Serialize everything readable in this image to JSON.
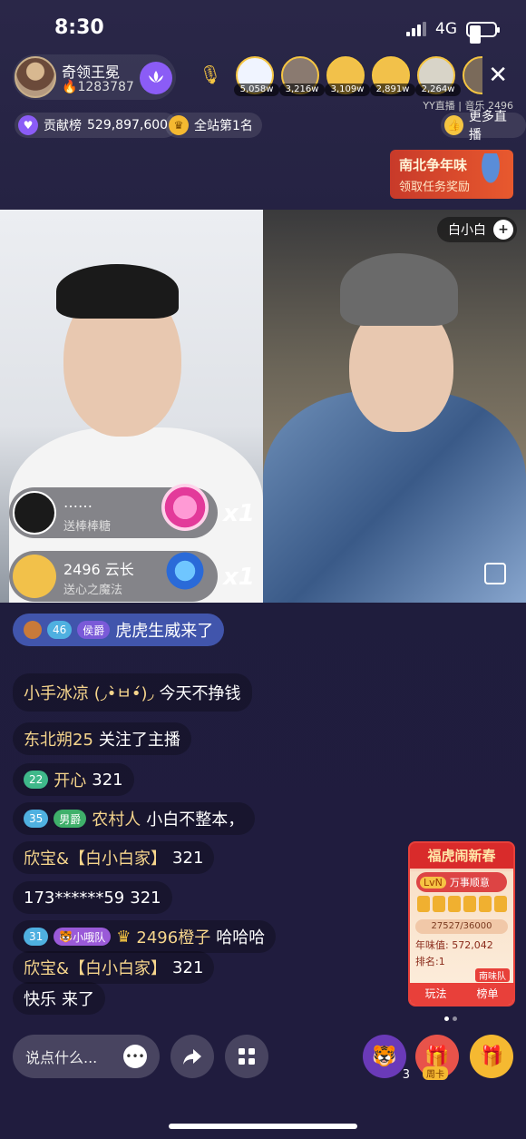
{
  "status_bar": {
    "time": "8:30",
    "network": "4G"
  },
  "host": {
    "name": "奇领王冕",
    "fans": "1283787"
  },
  "viewers": [
    {
      "count": "5,058w"
    },
    {
      "count": "3,216w"
    },
    {
      "count": "3,109w"
    },
    {
      "count": "2,891w"
    },
    {
      "count": "2,264w"
    },
    {
      "count": ""
    }
  ],
  "source_text": "YY直播 | 音乐 2496",
  "contribution": {
    "label": "贡献榜",
    "value": "529,897,600"
  },
  "site_rank": {
    "label": "全站第1名"
  },
  "more_live": {
    "label": "更多直播"
  },
  "promo": {
    "title": "南北争年味",
    "subtitle": "领取任务奖励"
  },
  "guest": {
    "name": "白小白"
  },
  "gifts": [
    {
      "name": "……",
      "action": "送棒棒糖",
      "multiplier": "x1"
    },
    {
      "name": "2496 云长",
      "action": "送心之魔法",
      "multiplier": "x1"
    }
  ],
  "chat": {
    "entry": {
      "level": "46",
      "rank": "侯爵",
      "text": "虎虎生威来了"
    },
    "messages": [
      {
        "user": "小手冰凉 (◞•̀ㅂ•́)◞",
        "text": "今天不挣钱"
      },
      {
        "user": "东北朔25",
        "text": "关注了主播"
      },
      {
        "level": "22",
        "user": "开心",
        "text": "321"
      },
      {
        "level": "35",
        "rank": "男爵",
        "user": "农村人",
        "text": "小白不整本，"
      },
      {
        "user": "欣宝&【白小白家】",
        "text": "321"
      },
      {
        "user": "173******59",
        "text": "321"
      },
      {
        "level": "31",
        "team": "小哦队",
        "user": "2496橙子",
        "text": "哈哈哈"
      },
      {
        "user": "欣宝&【白小白家】",
        "text": "321"
      },
      {
        "user": "快乐",
        "text": "来了"
      }
    ]
  },
  "event": {
    "title": "福虎闹新春",
    "level": "LvN",
    "level_text": "万事顺意",
    "progress": "27527/36000",
    "value_label": "年味值:",
    "value": "572,042",
    "rank_label": "排名:",
    "rank": "1",
    "team": "南味队",
    "play": "玩法",
    "board": "榜单"
  },
  "bottom": {
    "input_placeholder": "说点什么...",
    "badge_count": "3",
    "weekly_card": "周卡"
  }
}
